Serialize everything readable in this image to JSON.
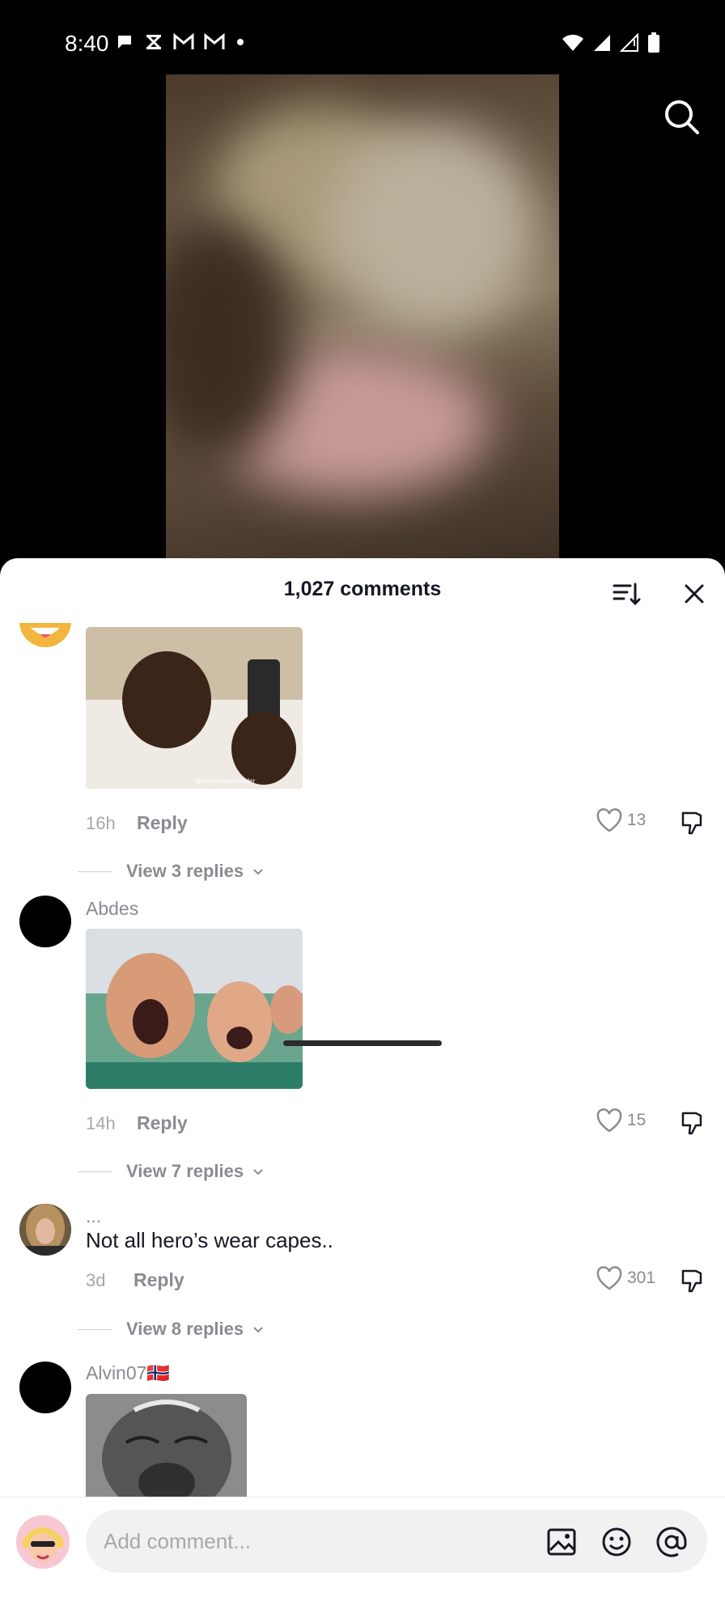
{
  "status_bar": {
    "time": "8:40",
    "left_icons": [
      "chat-bubble-icon",
      "x-logo-icon",
      "gmail-icon",
      "gmail-icon",
      "dot-icon"
    ],
    "right_icons": [
      "wifi-icon",
      "signal-icon",
      "signal-icon",
      "battery-icon"
    ]
  },
  "video": {
    "search_icon": "search-icon"
  },
  "sheet": {
    "title": "1,027 comments",
    "sort_icon": "sort-icon",
    "close_icon": "close-icon"
  },
  "comments": [
    {
      "username": "",
      "image": "reaction-meme-man-phone",
      "image_caption": "@amy.schoenwieder",
      "time": "16h",
      "reply_label": "Reply",
      "likes": "13",
      "view_replies": "View 3 replies"
    },
    {
      "username": "Abdes",
      "image": "reaction-meme-screaming-crowd",
      "time": "14h",
      "reply_label": "Reply",
      "likes": "15",
      "view_replies": "View 7 replies"
    },
    {
      "username": "...",
      "text": "Not all hero’s wear capes..",
      "time": "3d",
      "reply_label": "Reply",
      "likes": "301",
      "view_replies": "View 8 replies"
    },
    {
      "username": "Alvin07🇳🇴",
      "image": "reaction-meme-old-man"
    }
  ],
  "composer": {
    "placeholder": "Add comment...",
    "icons": [
      "image-icon",
      "emoji-icon",
      "mention-icon"
    ]
  },
  "colors": {
    "accent_text": "#161823",
    "muted_text": "#8a8b91",
    "input_bg": "#f1f1f2"
  }
}
